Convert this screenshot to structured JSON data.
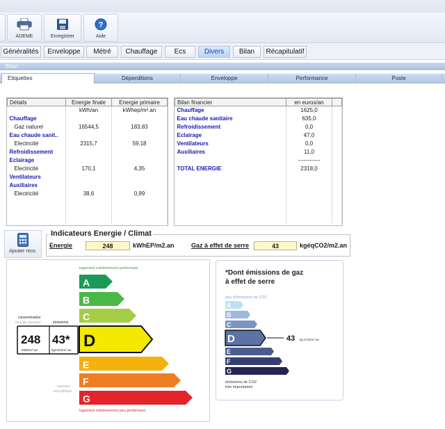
{
  "toolbar": {
    "buttons": [
      {
        "label": "ADEME",
        "icon": "printer-icon"
      },
      {
        "label": "Enregistrer",
        "icon": "floppy-disk-icon"
      },
      {
        "label": "Aide",
        "icon": "help-icon"
      }
    ]
  },
  "menu": {
    "tabs": [
      "Généralités",
      "Enveloppe",
      "Métré",
      "Chauffage",
      "Ecs",
      "Divers",
      "Bilan",
      "Récapitulatif"
    ],
    "active": "Divers"
  },
  "section": {
    "title": "Bilan"
  },
  "subtabs": {
    "items": [
      "Etiquettes",
      "Déperditions",
      "Enveloppe",
      "Performance",
      "Poste"
    ],
    "active": "Etiquettes"
  },
  "details_table": {
    "headers": [
      "Détails",
      "Energie finale",
      "Energie primaire"
    ],
    "units": [
      "",
      "kWh/an",
      "kWhep/m².an"
    ],
    "rows": [
      {
        "label": "Chauffage",
        "section": true,
        "finale": "",
        "primaire": ""
      },
      {
        "label": "Gaz naturel",
        "section": false,
        "finale": "16544,5",
        "primaire": "183,83"
      },
      {
        "label": "Eau chaude sanit..",
        "section": true,
        "finale": "",
        "primaire": ""
      },
      {
        "label": "Electricité",
        "section": false,
        "finale": "2315,7",
        "primaire": "59,18"
      },
      {
        "label": "Refroidissement",
        "section": true,
        "finale": "",
        "primaire": ""
      },
      {
        "label": "Eclairage",
        "section": true,
        "finale": "",
        "primaire": ""
      },
      {
        "label": "Electricité",
        "section": false,
        "finale": "170,1",
        "primaire": "4,35"
      },
      {
        "label": "Ventilateurs",
        "section": true,
        "finale": "",
        "primaire": ""
      },
      {
        "label": "Auxiliaires",
        "section": true,
        "finale": "",
        "primaire": ""
      },
      {
        "label": "Electricité",
        "section": false,
        "finale": "38,6",
        "primaire": "0,99"
      }
    ]
  },
  "financial_table": {
    "headers": [
      "Bilan financier",
      "en euros/an"
    ],
    "rows": [
      {
        "label": "Chauffage",
        "value": "1625,0"
      },
      {
        "label": "Eau chaude sanitaire",
        "value": "635,0"
      },
      {
        "label": "Refroidissement",
        "value": "0,0"
      },
      {
        "label": "Eclairage",
        "value": "47,0"
      },
      {
        "label": "Ventilateurs",
        "value": "0,0"
      },
      {
        "label": "Auxiliaires",
        "value": "11,0"
      },
      {
        "label": "",
        "value": "------------"
      },
      {
        "label": "TOTAL ENERGIE",
        "value": "2318,0"
      }
    ]
  },
  "indicators": {
    "title": "Indicateurs Energie / Climat",
    "calc_button": "Ajouter reco.",
    "energie_label": "Energie",
    "energie_value": "248",
    "energie_unit": "kWhEP/m2.an",
    "ges_label": "Gaz à effet de serre",
    "ges_value": "43",
    "ges_unit": "kgéqCO2/m2.an"
  },
  "energy_label": {
    "top_text": "logement extrêmement performant",
    "bottom_text": "logement extrêmement peu performant",
    "consommation": "consommation",
    "energie_primaire": "(énergie primaire)",
    "emissions": "émissions",
    "conso_value": "248",
    "emis_value": "43*",
    "conso_unit": "kWh/m².an",
    "emis_unit": "kgCO2/m².an",
    "side_text_1": "passoire",
    "side_text_2": "énergétique",
    "classes": [
      {
        "letter": "A",
        "color": "#1b9a55"
      },
      {
        "letter": "B",
        "color": "#4cb847"
      },
      {
        "letter": "C",
        "color": "#a6cd45"
      },
      {
        "letter": "D",
        "color": "#f3ea00"
      },
      {
        "letter": "E",
        "color": "#f5b10c"
      },
      {
        "letter": "F",
        "color": "#ef7d22"
      },
      {
        "letter": "G",
        "color": "#e3242b"
      }
    ],
    "active_class": "D"
  },
  "ges_label": {
    "title_line1": "*Dont émissions de gaz",
    "title_line2": "à effet de serre",
    "top_text": "peu d'émissions de CO2",
    "bottom_text_1": "émissions de CO2",
    "bottom_text_2": "très importantes",
    "value": "43",
    "unit": "kg CO2/m².an",
    "classes": [
      {
        "letter": "A",
        "color": "#bfe1f5"
      },
      {
        "letter": "B",
        "color": "#9cb8dc"
      },
      {
        "letter": "C",
        "color": "#7b95c2"
      },
      {
        "letter": "D",
        "color": "#5c73a6"
      },
      {
        "letter": "E",
        "color": "#4a5b8d"
      },
      {
        "letter": "F",
        "color": "#363f6f"
      },
      {
        "letter": "G",
        "color": "#25244e"
      }
    ],
    "active_class": "D"
  }
}
